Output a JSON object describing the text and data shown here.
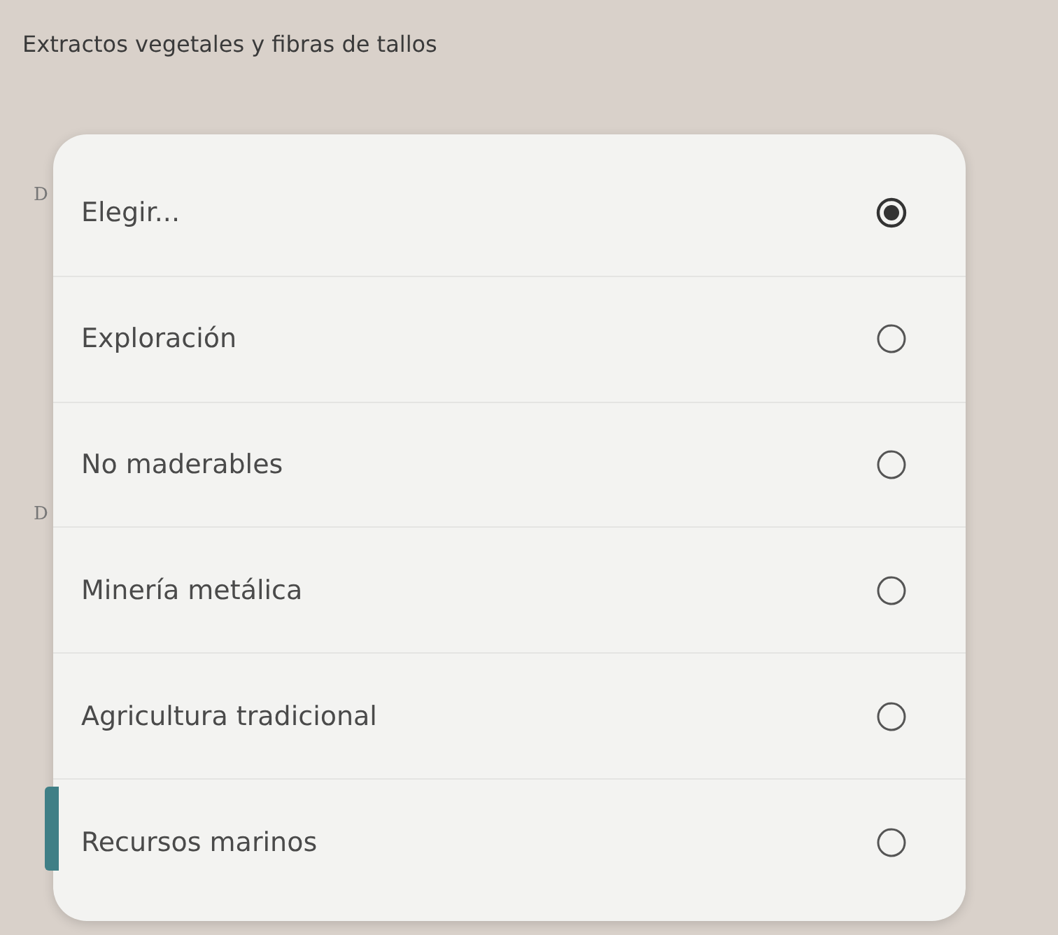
{
  "page": {
    "title": "Extractos vegetales y fibras de tallos",
    "background_fragments": [
      "D",
      "D"
    ]
  },
  "dialog": {
    "options": [
      {
        "label": "Elegir...",
        "selected": true
      },
      {
        "label": "Exploración",
        "selected": false
      },
      {
        "label": "No maderables",
        "selected": false
      },
      {
        "label": "Minería metálica",
        "selected": false
      },
      {
        "label": "Agricultura tradicional",
        "selected": false
      },
      {
        "label": "Recursos marinos",
        "selected": false
      }
    ]
  }
}
